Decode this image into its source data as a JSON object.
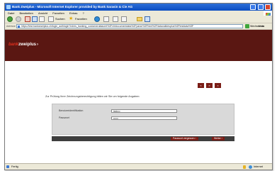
{
  "window": {
    "title": "Bank Zweiplus - Microsoft Internet Explorer provided by Bank Sarasin & Cie AG"
  },
  "menu": {
    "items": [
      "Datei",
      "Bearbeiten",
      "Ansicht",
      "Favoriten",
      "Extras",
      "?"
    ]
  },
  "toolbar": {
    "search_label": "Suchen",
    "favorites_label": "Favoriten"
  },
  "addressbar": {
    "label": "Adresse",
    "url": "https://test.bankzweiplus.ch/login_authlogin?ndres_banking_customerdatacert%2Fchtdocumentdata%2Fparse%2Fhtml%2Fdatavalidesplus%2Ftestdata%3F",
    "go_label": "Wechseln zu",
    "links_label": "Links"
  },
  "brand": {
    "accent": "bank",
    "name": "zweiplus"
  },
  "page": {
    "intro": "Zur Prüfung Ihrer Zeichnungsberechtigung bitten wir Sie um folgende Angaben:",
    "form": {
      "fields": [
        {
          "label": "Benutzeridentifikation",
          "value": "test••••"
        },
        {
          "label": "Passwort",
          "value": "••••••"
        }
      ]
    },
    "tool_buttons": [
      "«",
      "»",
      "×"
    ],
    "buttons": {
      "forgot": "Passwort vergessen  ›",
      "login": "Weiter  ›"
    }
  },
  "status": {
    "left": "Fertig",
    "zone": "Internet"
  }
}
